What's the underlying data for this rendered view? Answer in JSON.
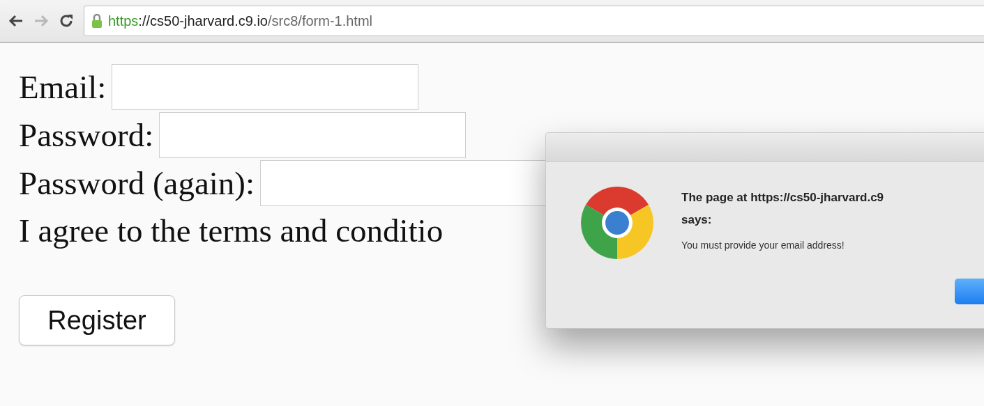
{
  "toolbar": {
    "back": {
      "disabled": false
    },
    "forward": {
      "disabled": true
    },
    "url": {
      "scheme": "https",
      "rest_host": "://cs50-jharvard.c9.io",
      "path": "/src8/form-1.html",
      "secure": true
    }
  },
  "form": {
    "fields": [
      {
        "label": "Email:"
      },
      {
        "label": "Password:"
      },
      {
        "label": "Password (again):"
      }
    ],
    "agreement": "I agree to the terms and conditio",
    "submit": "Register"
  },
  "dialog": {
    "title": "The page at https://cs50-jharvard.c9",
    "title_line2": "says:",
    "message": "You must provide your email address!"
  }
}
